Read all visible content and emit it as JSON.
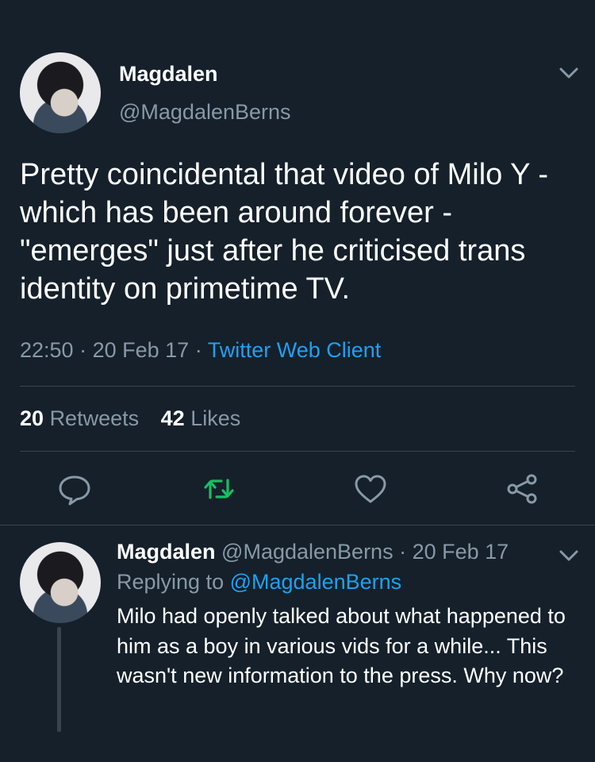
{
  "main_tweet": {
    "display_name": "Magdalen",
    "handle": "@MagdalenBerns",
    "text": "Pretty coincidental that video of Milo Y - which has been around forever -\"emerges\" just after he criticised trans identity on primetime TV.",
    "time": "22:50",
    "date": "20 Feb 17",
    "separator": "·",
    "client": "Twitter Web Client",
    "retweets_count": "20",
    "retweets_label": "Retweets",
    "likes_count": "42",
    "likes_label": "Likes"
  },
  "actions": {
    "reply_icon": "reply-bubble-icon",
    "retweet_icon": "retweet-icon",
    "like_icon": "heart-icon",
    "share_icon": "share-icon",
    "retweet_active_color": "#17bf63",
    "icon_color": "#8899a6"
  },
  "reply_tweet": {
    "display_name": "Magdalen",
    "handle": "@MagdalenBerns",
    "date": "20 Feb 17",
    "separator": "·",
    "replying_prefix": "Replying to",
    "replying_to": "@MagdalenBerns",
    "text": "Milo had openly talked about what happened to him as a boy in various vids for a while... This wasn't new information to the press. Why now?"
  },
  "colors": {
    "background": "#15202b",
    "secondary_text": "#8899a6",
    "link": "#1da1f2",
    "divider": "#38444d"
  }
}
